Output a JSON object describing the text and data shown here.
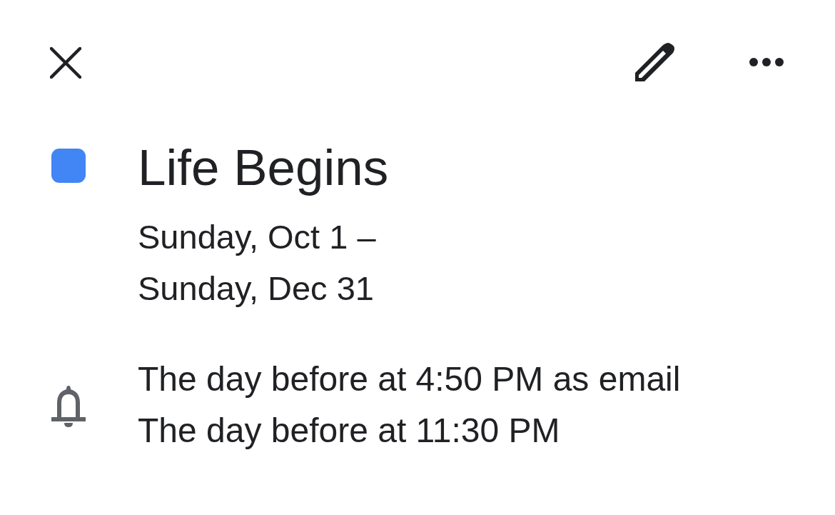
{
  "event": {
    "title": "Life Begins",
    "color": "#4285f4",
    "date_lines": [
      "Sunday, Oct 1 –",
      "Sunday, Dec 31"
    ]
  },
  "reminders": [
    "The day before at 4:50 PM as email",
    "The day before at 11:30 PM"
  ]
}
